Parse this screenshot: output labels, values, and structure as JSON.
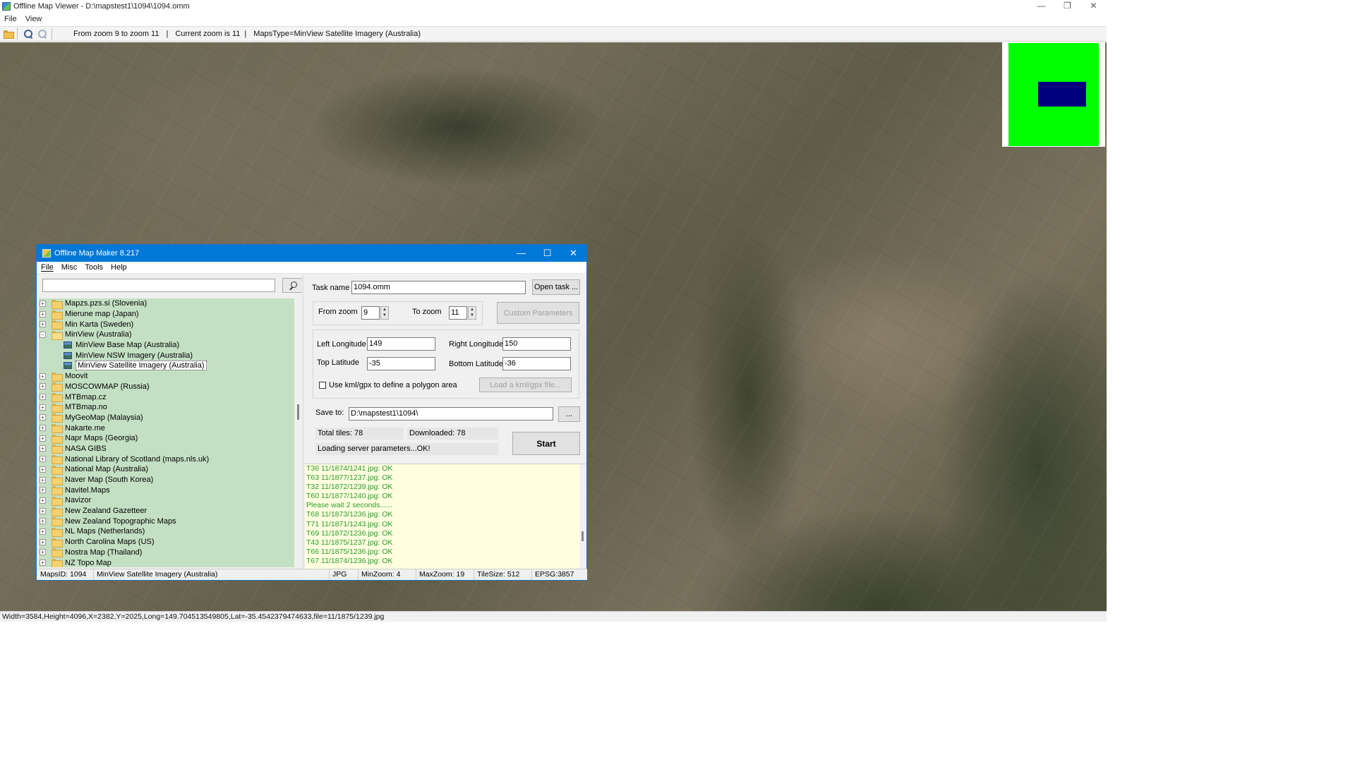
{
  "viewer": {
    "title": "Offline Map Viewer - D:\\mapstest1\\1094\\1094.omm",
    "window_controls": [
      "—",
      "❐",
      "✕"
    ],
    "menu": [
      "File",
      "View"
    ],
    "toolbar": {
      "zoom_range": "From zoom 9 to zoom 11",
      "current_zoom": "Current zoom is 11",
      "maps_type": "MapsType=MinView Satellite Imagery (Australia)"
    },
    "status": "Width=3584,Height=4096,X=2382,Y=2025,Long=149.704513549805,Lat=-35.4542379474633,file=11/1875/1239.jpg"
  },
  "dialog": {
    "title": "Offline Map Maker 8.217",
    "window_controls": [
      "—",
      "☐",
      "✕"
    ],
    "menu": [
      "File",
      "Misc",
      "Tools",
      "Help"
    ],
    "search": {
      "value": "",
      "placeholder": ""
    },
    "tree": [
      {
        "label": "Mapzs.pzs.si (Slovenia)",
        "type": "folder",
        "expanded": false
      },
      {
        "label": "Mierune map (Japan)",
        "type": "folder",
        "expanded": false
      },
      {
        "label": "Min Karta (Sweden)",
        "type": "folder",
        "expanded": false
      },
      {
        "label": "MinView (Australia)",
        "type": "folder",
        "expanded": true
      },
      {
        "label": "MinView Base Map (Australia)",
        "type": "leaf"
      },
      {
        "label": "MinView NSW Imagery (Australia)",
        "type": "leaf"
      },
      {
        "label": "MinView Satellite Imagery (Australia)",
        "type": "leaf",
        "selected": true
      },
      {
        "label": "Moovit",
        "type": "folder",
        "expanded": false
      },
      {
        "label": "MOSCOWMAP (Russia)",
        "type": "folder",
        "expanded": false
      },
      {
        "label": "MTBmap.cz",
        "type": "folder",
        "expanded": false
      },
      {
        "label": "MTBmap.no",
        "type": "folder",
        "expanded": false
      },
      {
        "label": "MyGeoMap (Malaysia)",
        "type": "folder",
        "expanded": false
      },
      {
        "label": "Nakarte.me",
        "type": "folder",
        "expanded": false
      },
      {
        "label": "Napr Maps (Georgia)",
        "type": "folder",
        "expanded": false
      },
      {
        "label": "NASA GIBS",
        "type": "folder",
        "expanded": false
      },
      {
        "label": "National Library of Scotland (maps.nls.uk)",
        "type": "folder",
        "expanded": false
      },
      {
        "label": "National Map (Australia)",
        "type": "folder",
        "expanded": false
      },
      {
        "label": "Naver Map (South Korea)",
        "type": "folder",
        "expanded": false
      },
      {
        "label": "Navitel.Maps",
        "type": "folder",
        "expanded": false
      },
      {
        "label": "Navizor",
        "type": "folder",
        "expanded": false
      },
      {
        "label": "New Zealand Gazetteer",
        "type": "folder",
        "expanded": false
      },
      {
        "label": "New Zealand Topographic Maps",
        "type": "folder",
        "expanded": false
      },
      {
        "label": "NL Maps (Netherlands)",
        "type": "folder",
        "expanded": false
      },
      {
        "label": "North Carolina Maps (US)",
        "type": "folder",
        "expanded": false
      },
      {
        "label": "Nostra Map (Thailand)",
        "type": "folder",
        "expanded": false
      },
      {
        "label": "NZ Topo Map",
        "type": "folder",
        "expanded": false
      }
    ],
    "task": {
      "name_label": "Task name",
      "name_value": "1094.omm",
      "open_task": "Open task ...",
      "from_zoom_label": "From zoom",
      "from_zoom_value": "9",
      "to_zoom_label": "To zoom",
      "to_zoom_value": "11",
      "custom_params": "Custom Parameters",
      "left_lon_label": "Left Longitude",
      "left_lon_value": "149",
      "right_lon_label": "Right Longitude",
      "right_lon_value": "150",
      "top_lat_label": "Top Latitude",
      "top_lat_value": "-35",
      "bottom_lat_label": "Bottom Latitude",
      "bottom_lat_value": "-36",
      "kml_label": "Use kml/gpx to define a polygon area",
      "kml_checked": false,
      "load_kml": "Load a kml/gpx file...",
      "save_to_label": "Save to:",
      "save_to_value": "D:\\mapstest1\\1094\\",
      "browse": "...",
      "total_tiles": "Total tiles: 78",
      "downloaded": "Downloaded: 78",
      "server_status": "Loading server parameters...OK!",
      "start": "Start"
    },
    "log": [
      "T36 11/1874/1241.jpg: OK",
      "T63 11/1877/1237.jpg: OK",
      "T32 11/1872/1239.jpg: OK",
      "T60 11/1877/1240.jpg: OK",
      "Please wait 2 seconds......",
      "T68 11/1873/1236.jpg: OK",
      "T71 11/1871/1243.jpg: OK",
      "T69 11/1872/1236.jpg: OK",
      "T43 11/1875/1237.jpg: OK",
      "T66 11/1875/1236.jpg: OK",
      "T67 11/1874/1236.jpg: OK"
    ],
    "status": {
      "maps_id": "MapsID: 1094",
      "map_name": "MinView Satellite Imagery (Australia)",
      "format": "JPG",
      "min_zoom": "MinZoom: 4",
      "max_zoom": "MaxZoom: 19",
      "tile_size": "TileSize: 512",
      "epsg": "EPSG:3857"
    }
  },
  "colors": {
    "dialog_titlebar": "#0078d7",
    "tree_background": "#c4e0c4",
    "log_background": "#ffffe0",
    "log_text": "#2a9a2a",
    "minimap_frame": "#00ff00",
    "minimap_view": "#00007f"
  }
}
